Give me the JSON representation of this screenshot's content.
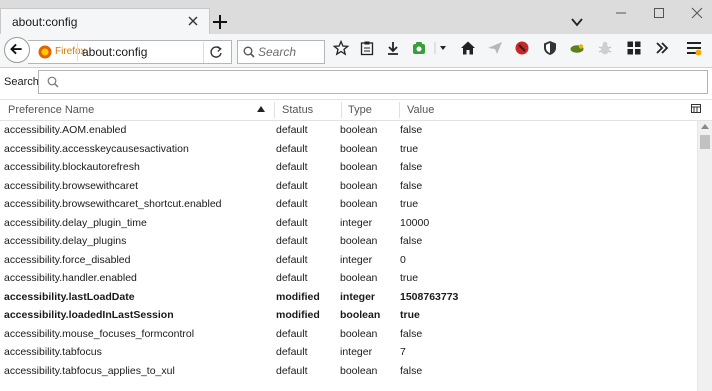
{
  "window": {
    "tab_title": "about:config",
    "controls": {
      "minimize": "minimize-icon",
      "maximize": "maximize-icon",
      "close": "close-icon"
    }
  },
  "navbar": {
    "identity_label": "Firefox",
    "url": "about:config",
    "search_placeholder": "Search",
    "toolbar_icons": [
      "star-icon",
      "clipboard-icon",
      "download-icon",
      "addon-icon",
      "dropdown-icon",
      "home-icon",
      "send-icon",
      "record-icon",
      "shield-icon",
      "bird-icon",
      "bug-icon",
      "grid-icon",
      "overflow-icon",
      "menu-icon"
    ]
  },
  "config": {
    "search_label": "Search:",
    "search_value": "",
    "columns": {
      "name": "Preference Name",
      "status": "Status",
      "type": "Type",
      "value": "Value"
    },
    "sort": {
      "column": "name",
      "direction": "asc"
    },
    "rows": [
      {
        "name": "accessibility.AOM.enabled",
        "status": "default",
        "type": "boolean",
        "value": "false"
      },
      {
        "name": "accessibility.accesskeycausesactivation",
        "status": "default",
        "type": "boolean",
        "value": "true"
      },
      {
        "name": "accessibility.blockautorefresh",
        "status": "default",
        "type": "boolean",
        "value": "false"
      },
      {
        "name": "accessibility.browsewithcaret",
        "status": "default",
        "type": "boolean",
        "value": "false"
      },
      {
        "name": "accessibility.browsewithcaret_shortcut.enabled",
        "status": "default",
        "type": "boolean",
        "value": "true"
      },
      {
        "name": "accessibility.delay_plugin_time",
        "status": "default",
        "type": "integer",
        "value": "10000"
      },
      {
        "name": "accessibility.delay_plugins",
        "status": "default",
        "type": "boolean",
        "value": "false"
      },
      {
        "name": "accessibility.force_disabled",
        "status": "default",
        "type": "integer",
        "value": "0"
      },
      {
        "name": "accessibility.handler.enabled",
        "status": "default",
        "type": "boolean",
        "value": "true"
      },
      {
        "name": "accessibility.lastLoadDate",
        "status": "modified",
        "type": "integer",
        "value": "1508763773"
      },
      {
        "name": "accessibility.loadedInLastSession",
        "status": "modified",
        "type": "boolean",
        "value": "true"
      },
      {
        "name": "accessibility.mouse_focuses_formcontrol",
        "status": "default",
        "type": "boolean",
        "value": "false"
      },
      {
        "name": "accessibility.tabfocus",
        "status": "default",
        "type": "integer",
        "value": "7"
      },
      {
        "name": "accessibility.tabfocus_applies_to_xul",
        "status": "default",
        "type": "boolean",
        "value": "false"
      }
    ]
  }
}
